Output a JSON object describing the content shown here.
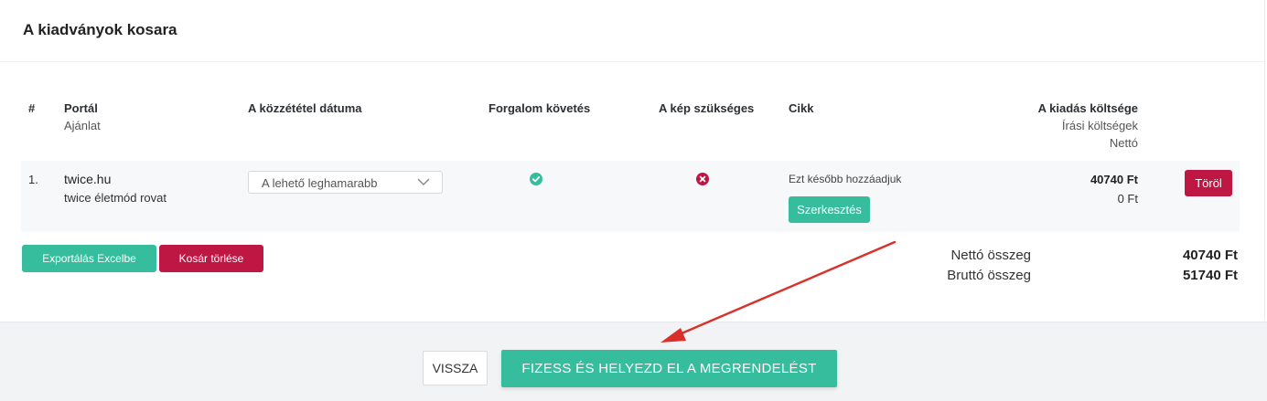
{
  "card": {
    "title": "A kiadványok kosara"
  },
  "table": {
    "headers": {
      "num": "#",
      "portal": "Portál",
      "portal_sub": "Ajánlat",
      "date": "A közzététel dátuma",
      "traffic": "Forgalom követés",
      "image": "A kép szükséges",
      "article": "Cikk",
      "cost": "A kiadás költsége",
      "cost_sub1": "Írási költségek",
      "cost_sub2": "Nettó"
    },
    "rows": [
      {
        "num": "1.",
        "portal": "twice.hu",
        "offer": "twice életmód rovat",
        "date_select": "A lehető leghamarabb",
        "traffic_tracking": true,
        "image_required": false,
        "article_status": "Ezt később hozzáadjuk",
        "edit_label": "Szerkesztés",
        "cost": "40740 Ft",
        "writing_cost": "0 Ft",
        "delete_label": "Töröl"
      }
    ]
  },
  "actions": {
    "export_label": "Exportálás Excelbe",
    "clear_label": "Kosár törlése"
  },
  "totals": {
    "net_label": "Nettó összeg",
    "net_value": "40740 Ft",
    "gross_label": "Bruttó összeg",
    "gross_value": "51740 Ft"
  },
  "footer": {
    "back_label": "VISSZA",
    "pay_label": "FIZESS ÉS HELYEZD EL A MEGRENDELÉST"
  },
  "icons": {
    "traffic": "check-circle-icon",
    "image": "x-circle-icon",
    "select": "chevron-down-icon"
  },
  "colors": {
    "accent": "#35bd9d",
    "danger": "#bf1743",
    "arrow": "#d9302a"
  }
}
